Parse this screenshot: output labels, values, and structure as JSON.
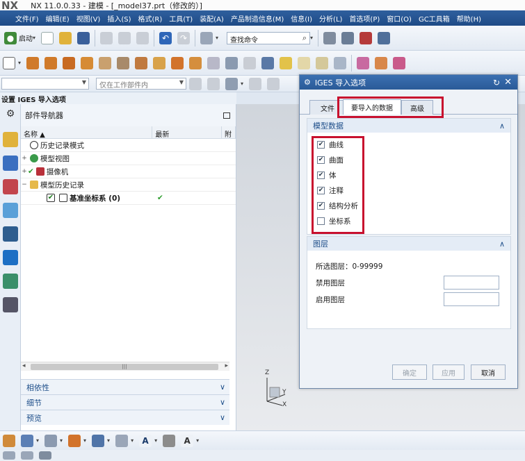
{
  "window": {
    "logo": "NX",
    "title": "NX 11.0.0.33 - 建模 - [_model37.prt（修改的）]"
  },
  "menubar": {
    "items": [
      "文件(F)",
      "编辑(E)",
      "视图(V)",
      "插入(S)",
      "格式(R)",
      "工具(T)",
      "装配(A)",
      "产品制造信息(M)",
      "信息(I)",
      "分析(L)",
      "首选项(P)",
      "窗口(O)",
      "GC工具箱",
      "帮助(H)"
    ]
  },
  "toolbar": {
    "start_label": "启动",
    "command_search_placeholder": "查找命令"
  },
  "selection_bar": {
    "type_filter_value": "",
    "scope_filter_value": "仅在工作部件内"
  },
  "set_bar": {
    "label": "设置 IGES 导入选项"
  },
  "navigator": {
    "title": "部件导航器",
    "columns": {
      "name": "名称",
      "latest": "最新",
      "extra": "附"
    },
    "rows": [
      {
        "label": "历史记录模式",
        "latest": ""
      },
      {
        "label": "模型视图",
        "latest": ""
      },
      {
        "label": "摄像机",
        "latest": ""
      },
      {
        "label": "模型历史记录",
        "latest": ""
      },
      {
        "label": "基准坐标系 (0)",
        "latest": "✔"
      }
    ],
    "sections": [
      "相依性",
      "细节",
      "预览"
    ]
  },
  "triad": {
    "z": "Z",
    "y": "Y",
    "x": "X"
  },
  "dialog": {
    "title": "IGES 导入选项",
    "tabs": [
      "文件",
      "要导入的数据",
      "高级"
    ],
    "model_data": {
      "header": "模型数据",
      "options": [
        {
          "label": "曲线",
          "checked": true
        },
        {
          "label": "曲面",
          "checked": true
        },
        {
          "label": "体",
          "checked": true
        },
        {
          "label": "注释",
          "checked": true
        },
        {
          "label": "结构分析",
          "checked": true
        },
        {
          "label": "坐标系",
          "checked": false
        }
      ]
    },
    "layers": {
      "header": "图层",
      "selected_layers": "所选图层：0-99999",
      "disabled_label": "禁用图层",
      "enabled_label": "启用图层",
      "disabled_value": "",
      "enabled_value": ""
    },
    "buttons": {
      "ok": "确定",
      "apply": "应用",
      "cancel": "取消"
    }
  },
  "colors": {
    "menubar": "#2a5a98",
    "dialog_title": "#3366a8",
    "highlight": "#c8102e",
    "section_text": "#1f4f8a"
  }
}
